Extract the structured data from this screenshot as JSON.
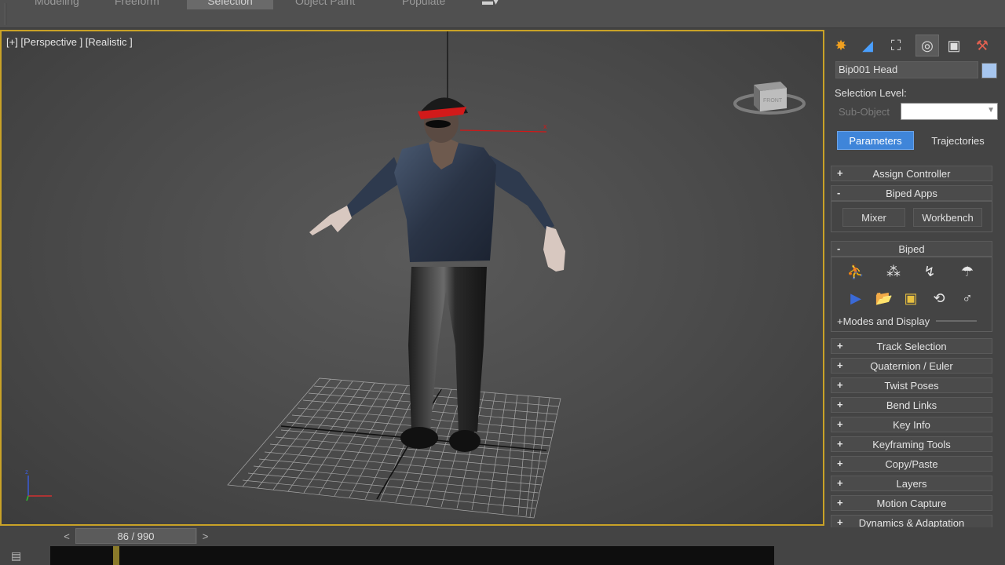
{
  "ribbon": {
    "tabs": [
      {
        "label": "Modeling",
        "active": false
      },
      {
        "label": "Freeform",
        "active": false
      },
      {
        "label": "Selection",
        "active": true
      },
      {
        "label": "Object Paint",
        "active": false
      },
      {
        "label": "Populate",
        "active": false
      }
    ]
  },
  "viewport": {
    "label": "[+] [Perspective ] [Realistic ]",
    "active_border_color": "#c9a227",
    "viewcube_label": "FRONT"
  },
  "command_panel": {
    "tab_icons": [
      "create-icon",
      "modify-icon",
      "hierarchy-icon",
      "motion-icon",
      "display-icon",
      "utilities-icon"
    ],
    "object_name": "Bip001 Head",
    "object_color": "#a7c6ee",
    "selection_level_label": "Selection Level:",
    "sub_object_label": "Sub-Object",
    "sub_object_value": "",
    "buttons": {
      "parameters": "Parameters",
      "trajectories": "Trajectories"
    },
    "rollouts_top": [
      {
        "sign": "+",
        "label": "Assign Controller"
      },
      {
        "sign": "-",
        "label": "Biped Apps"
      }
    ],
    "biped_apps": {
      "mixer": "Mixer",
      "workbench": "Workbench"
    },
    "biped_rollout": {
      "sign": "-",
      "label": "Biped"
    },
    "biped_icons_row1": [
      "figure-mode-icon",
      "footstep-mode-icon",
      "motion-flow-icon",
      "mixer-mode-icon"
    ],
    "biped_icons_row2": [
      "playback-icon",
      "load-file-icon",
      "save-file-icon",
      "convert-icon",
      "move-all-icon"
    ],
    "modes_and_display": "+Modes and Display",
    "rollouts_bottom": [
      {
        "sign": "+",
        "label": "Track Selection"
      },
      {
        "sign": "+",
        "label": "Quaternion / Euler"
      },
      {
        "sign": "+",
        "label": "Twist Poses"
      },
      {
        "sign": "+",
        "label": "Bend Links"
      },
      {
        "sign": "+",
        "label": "Key Info"
      },
      {
        "sign": "+",
        "label": "Keyframing Tools"
      },
      {
        "sign": "+",
        "label": "Copy/Paste"
      },
      {
        "sign": "+",
        "label": "Layers"
      },
      {
        "sign": "+",
        "label": "Motion Capture"
      },
      {
        "sign": "+",
        "label": "Dynamics & Adaptation"
      }
    ]
  },
  "time_slider": {
    "prev": "<",
    "next": ">",
    "current_frame": 86,
    "total_frames": 990,
    "label": "86 / 990"
  }
}
